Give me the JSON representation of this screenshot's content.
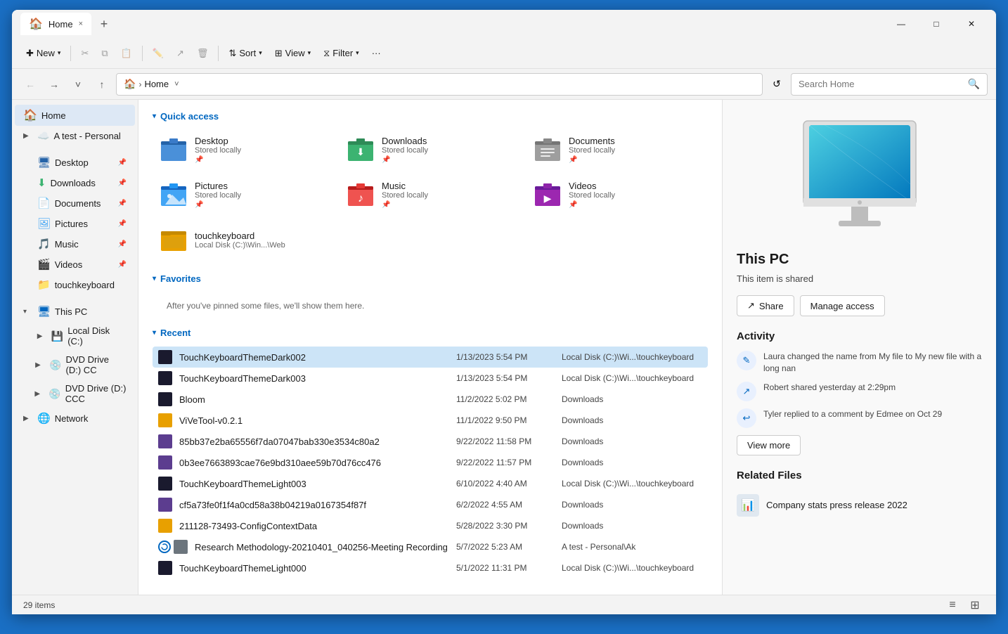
{
  "window": {
    "title": "Home",
    "tab_label": "Home",
    "tab_close": "×",
    "tab_new": "+",
    "controls": {
      "minimize": "—",
      "maximize": "□",
      "close": "✕"
    }
  },
  "toolbar": {
    "new_label": "New",
    "cut_icon": "✂",
    "copy_icon": "⧉",
    "paste_icon": "📋",
    "rename_icon": "✎",
    "share_icon": "↗",
    "delete_icon": "🗑",
    "sort_label": "Sort",
    "view_label": "View",
    "filter_label": "Filter",
    "more_label": "···"
  },
  "address_bar": {
    "back": "←",
    "forward": "→",
    "recent_locations": "˅",
    "up": "↑",
    "path": "Home",
    "refresh": "↺",
    "search_placeholder": "Search Home"
  },
  "sidebar": {
    "home_label": "Home",
    "test_personal_label": "A test - Personal",
    "items": [
      {
        "label": "Desktop",
        "icon": "🖥",
        "pinnable": true
      },
      {
        "label": "Downloads",
        "icon": "⬇",
        "pinnable": true
      },
      {
        "label": "Documents",
        "icon": "📄",
        "pinnable": true
      },
      {
        "label": "Pictures",
        "icon": "🖼",
        "pinnable": true
      },
      {
        "label": "Music",
        "icon": "🎵",
        "pinnable": true
      },
      {
        "label": "Videos",
        "icon": "🎬",
        "pinnable": true
      },
      {
        "label": "touchkeyboard",
        "icon": "📁",
        "pinnable": false
      }
    ],
    "this_pc_label": "This PC",
    "local_disk_label": "Local Disk (C:)",
    "dvd_drive_d_cc": "DVD Drive (D:) CC",
    "dvd_drive_d_ccc": "DVD Drive (D:) CCC",
    "network_label": "Network"
  },
  "quick_access": {
    "section_label": "Quick access",
    "items": [
      {
        "name": "Desktop",
        "sub": "Stored locally",
        "color": "desktop"
      },
      {
        "name": "Downloads",
        "sub": "Stored locally",
        "color": "downloads"
      },
      {
        "name": "Documents",
        "sub": "Stored locally",
        "color": "documents"
      },
      {
        "name": "Pictures",
        "sub": "Stored locally",
        "color": "pictures"
      },
      {
        "name": "Music",
        "sub": "Stored locally",
        "color": "music"
      },
      {
        "name": "Videos",
        "sub": "Stored locally",
        "color": "videos"
      },
      {
        "name": "touchkeyboard",
        "sub": "Local Disk (C:)\\Win...\\Web",
        "color": "folder"
      }
    ]
  },
  "favorites": {
    "section_label": "Favorites",
    "empty_text": "After you've pinned some files, we'll show them here."
  },
  "recent": {
    "section_label": "Recent",
    "items": [
      {
        "name": "TouchKeyboardThemeDark002",
        "date": "1/13/2023 5:54 PM",
        "location": "Local Disk (C:)\\Wi...\\touchkeyboard",
        "icon": "dark",
        "selected": true
      },
      {
        "name": "TouchKeyboardThemeDark003",
        "date": "1/13/2023 5:54 PM",
        "location": "Local Disk (C:)\\Wi...\\touchkeyboard",
        "icon": "dark",
        "selected": false
      },
      {
        "name": "Bloom",
        "date": "11/2/2022 5:02 PM",
        "location": "Downloads",
        "icon": "dark",
        "selected": false
      },
      {
        "name": "ViVeTool-v0.2.1",
        "date": "11/1/2022 9:50 PM",
        "location": "Downloads",
        "icon": "folder",
        "selected": false
      },
      {
        "name": "85bb37e2ba65556f7da07047bab330e3534c80a2",
        "date": "9/22/2022 11:58 PM",
        "location": "Downloads",
        "icon": "img",
        "selected": false
      },
      {
        "name": "0b3ee7663893cae76e9bd310aee59b70d76cc476",
        "date": "9/22/2022 11:57 PM",
        "location": "Downloads",
        "icon": "img",
        "selected": false
      },
      {
        "name": "TouchKeyboardThemeLight003",
        "date": "6/10/2022 4:40 AM",
        "location": "Local Disk (C:)\\Wi...\\touchkeyboard",
        "icon": "dark",
        "selected": false
      },
      {
        "name": "cf5a73fe0f1f4a0cd58a38b04219a0167354f87f",
        "date": "6/2/2022 4:55 AM",
        "location": "Downloads",
        "icon": "img",
        "selected": false
      },
      {
        "name": "211128-73493-ConfigContextData",
        "date": "5/28/2022 3:30 PM",
        "location": "Downloads",
        "icon": "folder",
        "selected": false
      },
      {
        "name": "Research Methodology-20210401_040256-Meeting Recording",
        "date": "5/7/2022 5:23 AM",
        "location": "A test - Personal\\Ak",
        "icon": "rec",
        "selected": false
      },
      {
        "name": "TouchKeyboardThemeLight000",
        "date": "5/1/2022 11:31 PM",
        "location": "Local Disk (C:)\\Wi...\\touchkeyboard",
        "icon": "dark",
        "selected": false
      }
    ]
  },
  "status_bar": {
    "items_count": "29 items",
    "view_list": "≡",
    "view_grid": "⊞"
  },
  "right_panel": {
    "pc_title": "This PC",
    "pc_subtitle": "This item is shared",
    "share_btn": "Share",
    "manage_access_btn": "Manage access",
    "activity_title": "Activity",
    "activity_items": [
      {
        "text": "Laura changed the name from My file to My new file with a long nan",
        "icon": "✎"
      },
      {
        "text": "Robert shared yesterday at 2:29pm",
        "icon": "↗"
      },
      {
        "text": "Tyler replied to a comment by Edmee on Oct 29",
        "icon": "↩"
      }
    ],
    "view_more_btn": "View more",
    "related_title": "Related Files",
    "related_items": [
      {
        "name": "Company stats press release 2022",
        "icon": "📊"
      }
    ]
  },
  "colors": {
    "accent": "#0067c0",
    "selected_bg": "#cce4f7",
    "sidebar_active": "#dde8f5"
  }
}
